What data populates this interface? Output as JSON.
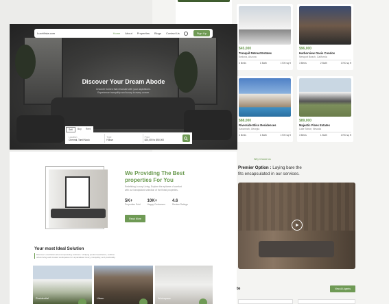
{
  "nav": {
    "logo": "LuxeVista.com",
    "links": [
      "Home",
      "About",
      "Properties",
      "Blogs",
      "Contact Us"
    ],
    "signup": "Sign Up"
  },
  "hero": {
    "title": "Discover Your Dream Abode",
    "subtitle": "Uncover homes that resonate with your aspirations. Experience tranquility and luxury in every corner.",
    "tabs": [
      "Sell",
      "Buy",
      "Rent"
    ],
    "search": {
      "location_label": "Location",
      "location_value": "Chennai, Tamil Nadu",
      "type_label": "Type",
      "type_value": "House",
      "price_label": "Price",
      "price_value": "$20,000 to $50,000"
    }
  },
  "properties": [
    {
      "price": "$45,000",
      "name": "Tranquil Retreat Estates",
      "location": "Sedona, Arizona",
      "beds": "3 Beds",
      "baths": "1 Bath",
      "size": "1700 sq ft"
    },
    {
      "price": "$96,000",
      "name": "Harborview Oasis Condos",
      "location": "Newport Beach, California",
      "beds": "3 Beds",
      "baths": "2 Bath",
      "size": "1700 sq ft"
    },
    {
      "price": "$88,000",
      "name": "Riverside Bliss Residences",
      "location": "Savannah, Georgia",
      "beds": "4 Beds",
      "baths": "1 Bath",
      "size": "1700 sq ft"
    },
    {
      "price": "$89,000",
      "name": "Majestic Pines Estates",
      "location": "Lake Tahoe, Nevada",
      "beds": "3 Beds",
      "baths": "1 Bath",
      "size": "1700 sq ft"
    }
  ],
  "about": {
    "title": "We Providing The Best properties For You",
    "description": "Redefining Luxury Living. Explore the epitome of comfort with our handpicked selection of the finest properties.",
    "stats": [
      {
        "value": "5K+",
        "label": "Properties Sold"
      },
      {
        "value": "10K+",
        "label": "Happy Customers"
      },
      {
        "value": "4.6",
        "label": "Review Ratings"
      }
    ],
    "button": "Read More"
  },
  "ideal": {
    "title": "Your most Ideal Solution",
    "description": "Discover LuxeVista's all-encompassing solutions. Unifying opulent aesthetics, sublime urban living and curated workspaces for unparalleled luxury, tranquility, and practicality.",
    "cards": [
      "Residential",
      "Urban",
      "Workspace"
    ]
  },
  "choose": {
    "tag": "Why Choose us",
    "title_bold": "Premier Option :",
    "title_rest": " Laying bare the",
    "title_line2": "fits encapsulated in our services."
  },
  "agents": {
    "label": "te",
    "button": "View All Agents"
  },
  "colors": {
    "accent": "#6f9a55",
    "accent_text": "#6a9a4f"
  }
}
